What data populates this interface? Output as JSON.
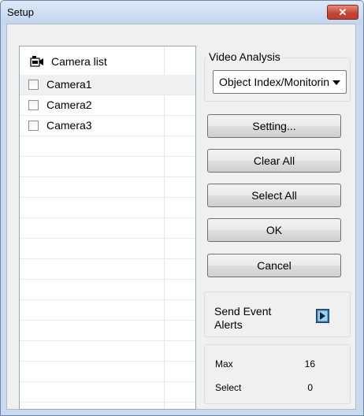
{
  "window": {
    "title": "Setup",
    "close_glyph": "✕"
  },
  "camera_list": {
    "header": "Camera list",
    "header_icon": "camera-icon",
    "items": [
      {
        "label": "Camera1",
        "checked": false
      },
      {
        "label": "Camera2",
        "checked": false
      },
      {
        "label": "Camera3",
        "checked": false
      }
    ]
  },
  "video_analysis": {
    "title": "Video Analysis",
    "selected": "Object Index/Monitoring"
  },
  "buttons": {
    "setting": "Setting...",
    "clear_all": "Clear All",
    "select_all": "Select All",
    "ok": "OK",
    "cancel": "Cancel"
  },
  "send_event": {
    "line1": "Send Event",
    "line2": "Alerts",
    "icon": "send-arrow-icon"
  },
  "stats": {
    "max_label": "Max",
    "max_value": "16",
    "select_label": "Select",
    "select_value": "0"
  },
  "colors": {
    "close_button": "#c24332",
    "title_bar": "#c2d5ee",
    "client_bg": "#f0f0f0"
  }
}
